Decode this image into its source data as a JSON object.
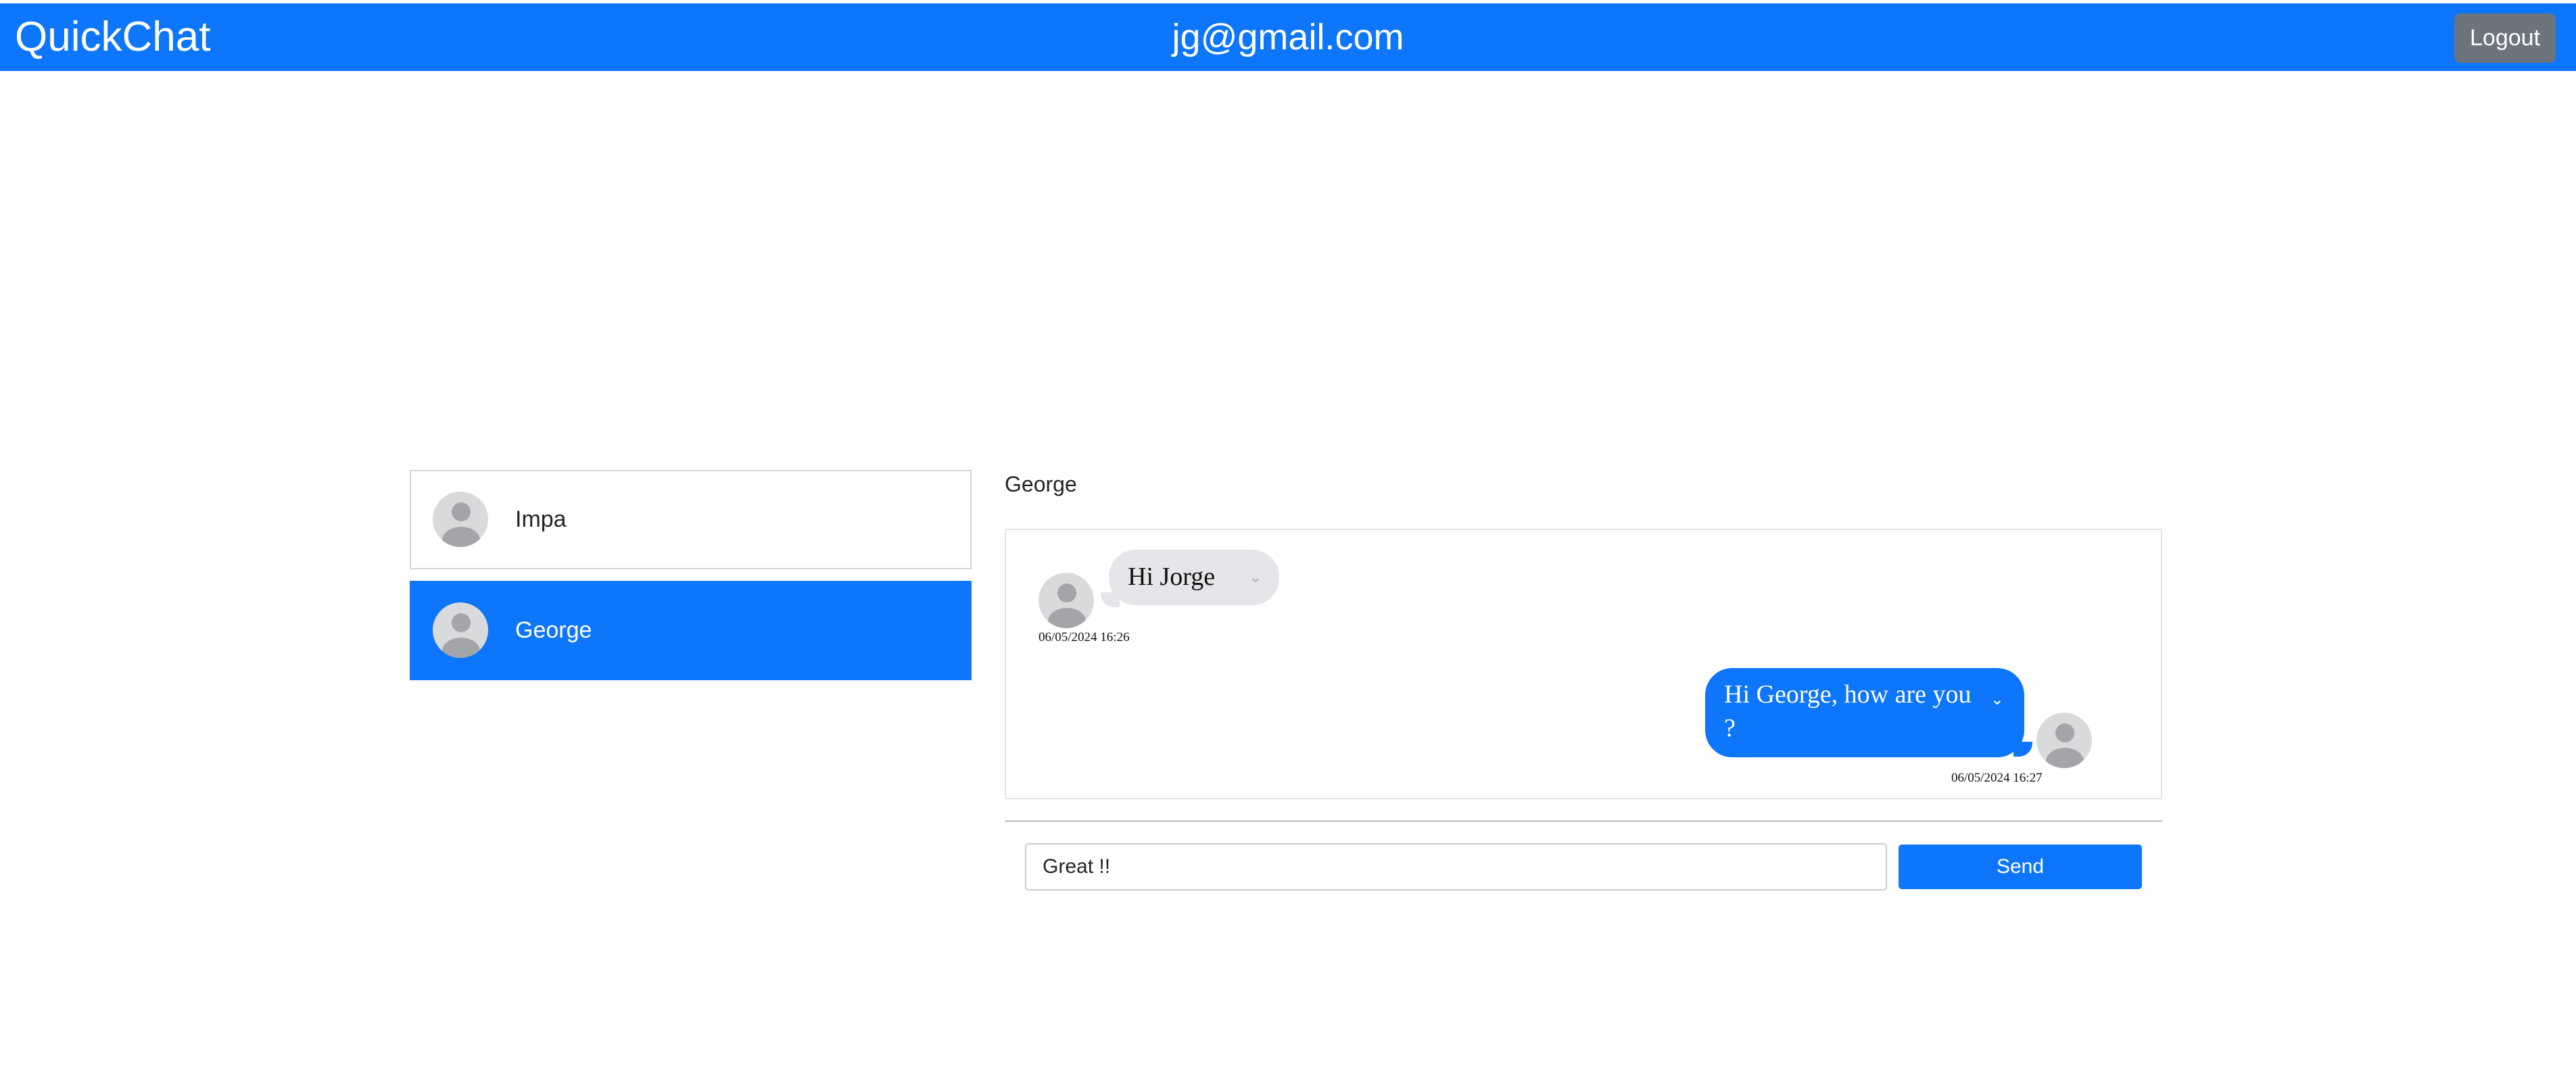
{
  "header": {
    "brand": "QuickChat",
    "user_email": "jg@gmail.com",
    "logout_label": "Logout"
  },
  "contacts": [
    {
      "name": "Impa",
      "active": false
    },
    {
      "name": "George",
      "active": true
    }
  ],
  "chat": {
    "title": "George",
    "messages": [
      {
        "text": "Hi Jorge",
        "time": "06/05/2024 16:26",
        "side": "received"
      },
      {
        "text": "Hi George, how are you ?",
        "time": "06/05/2024 16:27",
        "side": "sent"
      }
    ]
  },
  "compose": {
    "value": "Great !!",
    "send_label": "Send"
  },
  "colors": {
    "primary": "#0d76fb",
    "secondary": "#6c757d",
    "bubble_received": "#e5e5ea"
  },
  "icons": {
    "avatar": "user-placeholder-icon",
    "message_menu": "chevron-down-icon"
  }
}
